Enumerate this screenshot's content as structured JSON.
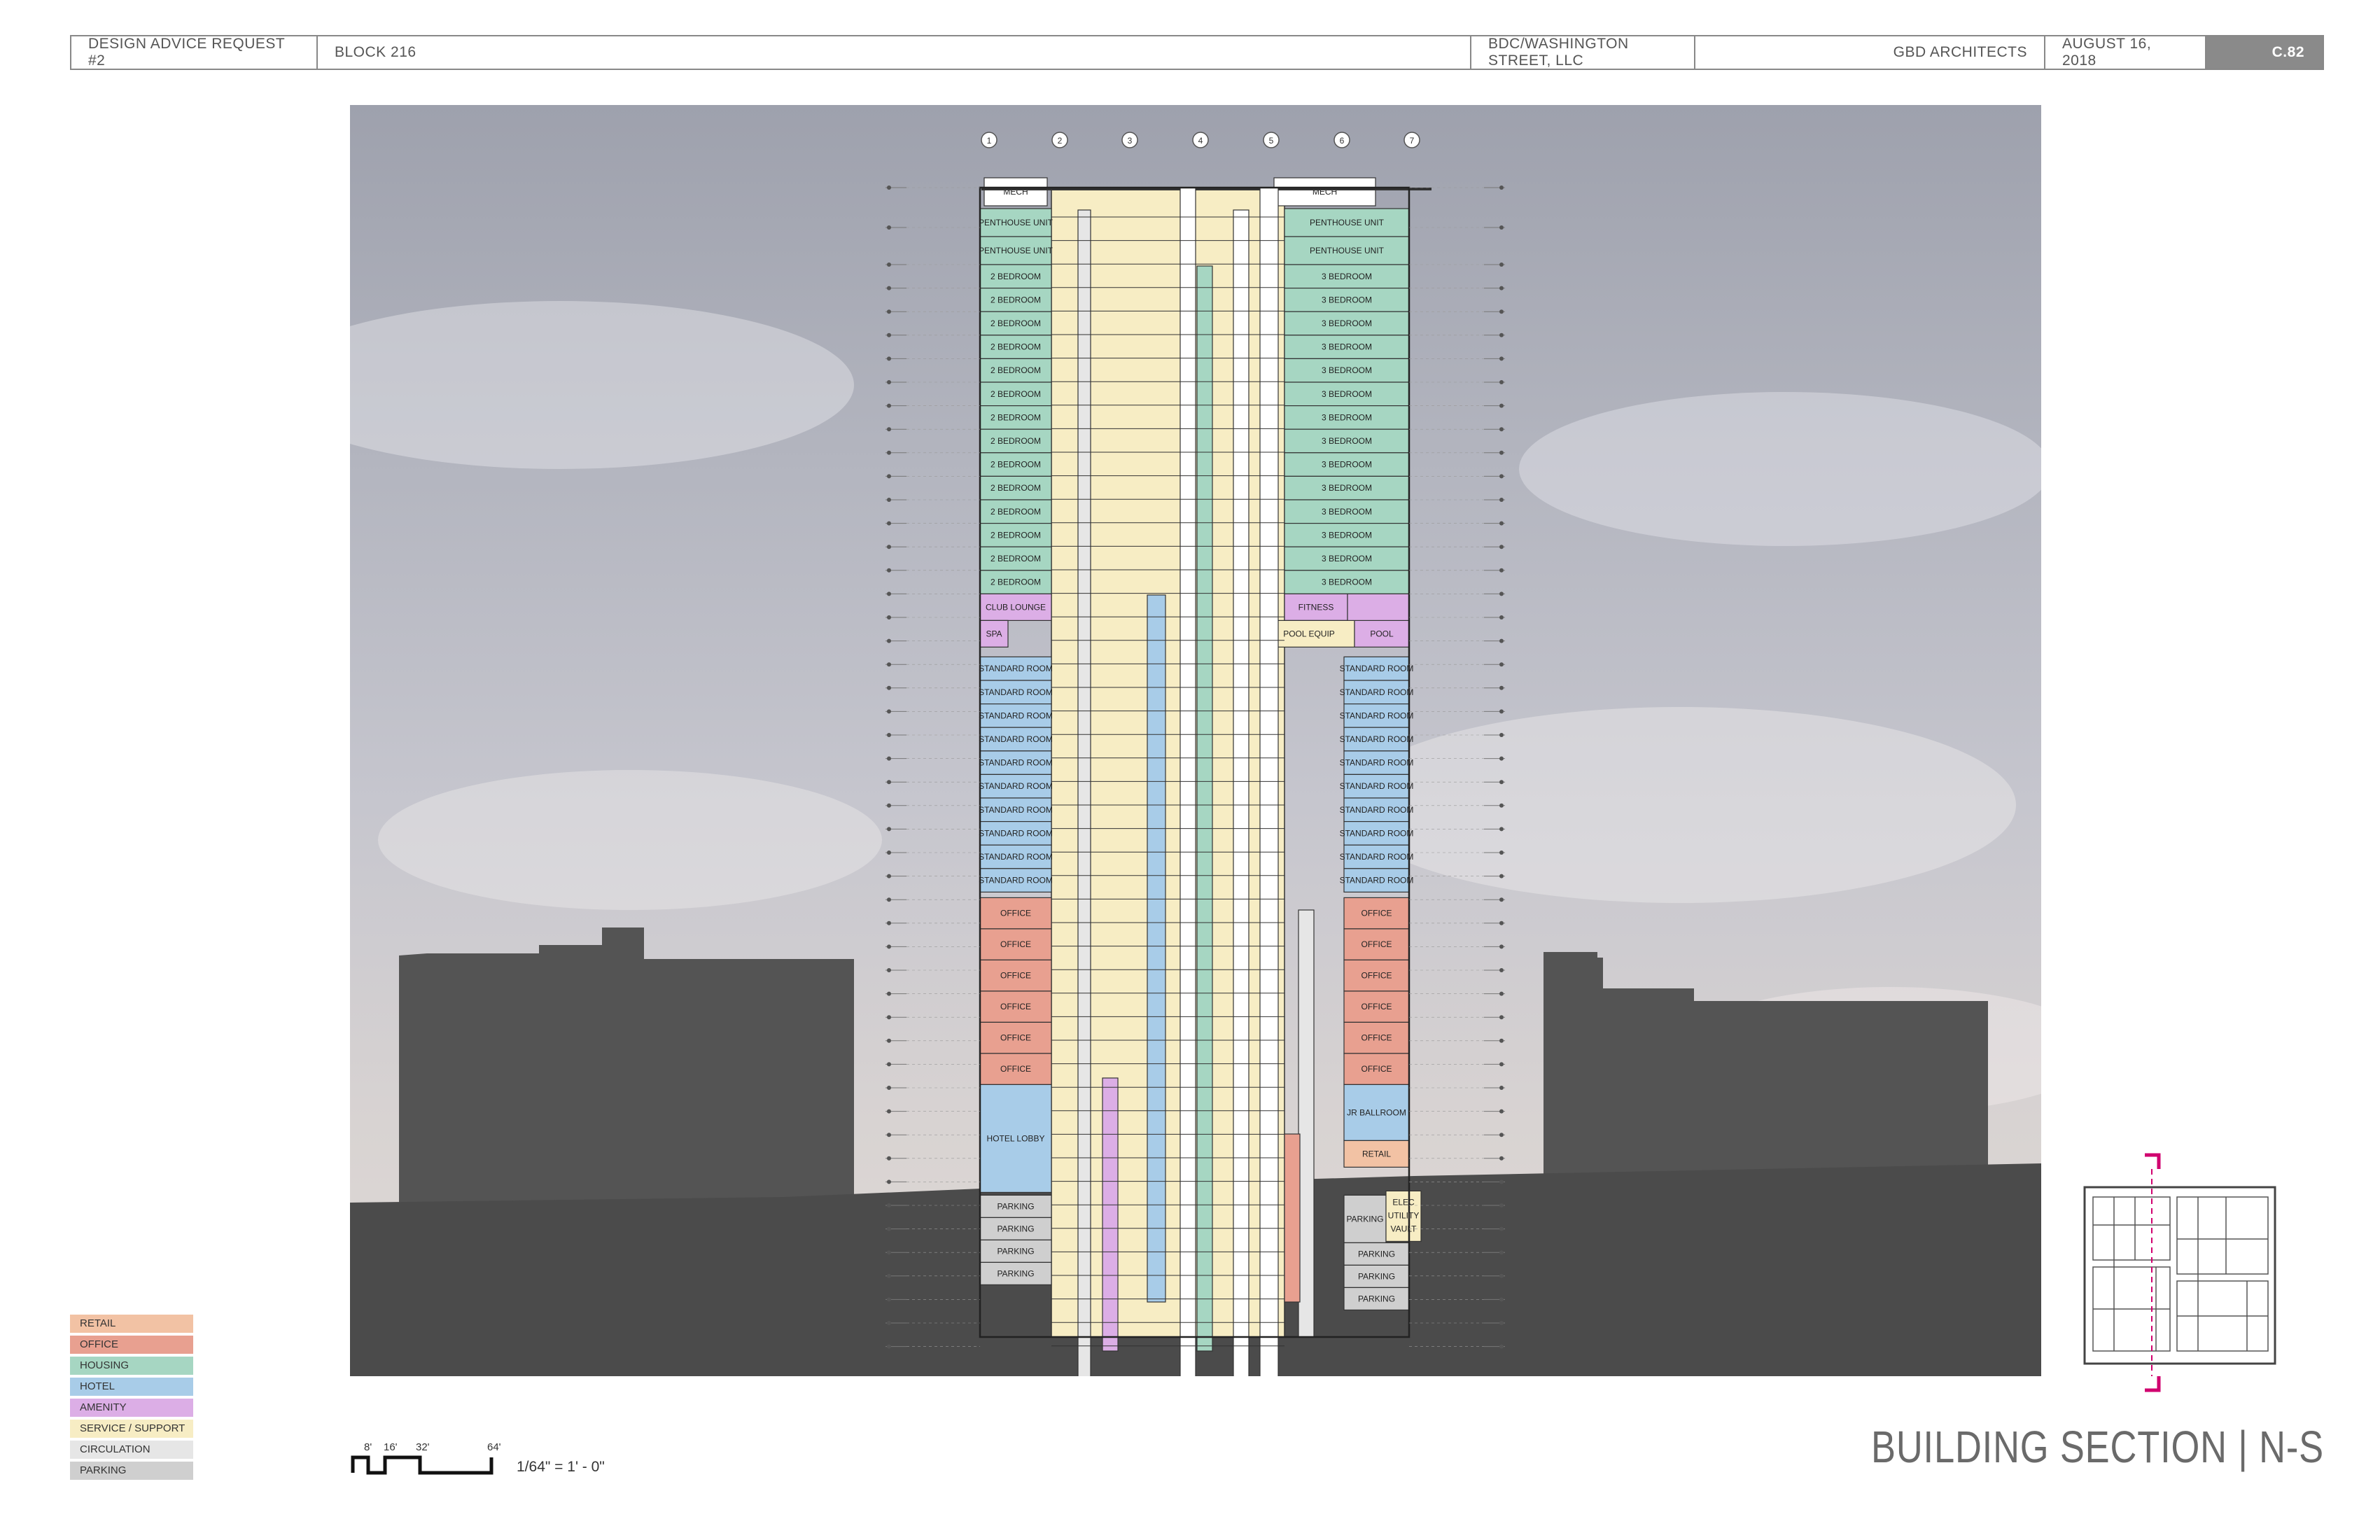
{
  "header": {
    "request": "DESIGN ADVICE REQUEST #2",
    "block": "BLOCK 216",
    "client": "BDC/WASHINGTON STREET, LLC",
    "architect": "GBD ARCHITECTS",
    "date": "AUGUST 16,  2018",
    "sheet": "C.82"
  },
  "grid_lines": [
    "1",
    "2",
    "3",
    "4",
    "5",
    "6",
    "7"
  ],
  "colors": {
    "retail": "#f2c2a4",
    "office": "#e8a090",
    "housing": "#a6d6c2",
    "hotel": "#a8cce8",
    "amenity": "#dcaee6",
    "service": "#f7edc4",
    "circulation": "#e6e6e6",
    "parking": "#cfcfcf"
  },
  "legend": [
    {
      "label": "RETAIL",
      "color": "#f2c2a4"
    },
    {
      "label": "OFFICE",
      "color": "#e8a090"
    },
    {
      "label": "HOUSING",
      "color": "#a6d6c2"
    },
    {
      "label": "HOTEL",
      "color": "#a8cce8"
    },
    {
      "label": "AMENITY",
      "color": "#dcaee6"
    },
    {
      "label": "SERVICE / SUPPORT",
      "color": "#f7edc4"
    },
    {
      "label": "CIRCULATION",
      "color": "#e6e6e6"
    },
    {
      "label": "PARKING",
      "color": "#cfcfcf"
    }
  ],
  "section": {
    "mech_left": "MECH",
    "mech_right": "MECH",
    "penthouse_left": [
      "PENTHOUSE UNIT",
      "PENTHOUSE UNIT"
    ],
    "penthouse_right": [
      "PENTHOUSE UNIT",
      "PENTHOUSE UNIT"
    ],
    "housing_left": [
      "2 BEDROOM",
      "2 BEDROOM",
      "2 BEDROOM",
      "2 BEDROOM",
      "2 BEDROOM",
      "2 BEDROOM",
      "2 BEDROOM",
      "2 BEDROOM",
      "2 BEDROOM",
      "2 BEDROOM",
      "2 BEDROOM",
      "2 BEDROOM",
      "2 BEDROOM",
      "2 BEDROOM"
    ],
    "housing_right": [
      "3 BEDROOM",
      "3 BEDROOM",
      "3 BEDROOM",
      "3 BEDROOM",
      "3 BEDROOM",
      "3 BEDROOM",
      "3 BEDROOM",
      "3 BEDROOM",
      "3 BEDROOM",
      "3 BEDROOM",
      "3 BEDROOM",
      "3 BEDROOM",
      "3 BEDROOM",
      "3 BEDROOM"
    ],
    "club_lounge": "CLUB LOUNGE",
    "fitness": "FITNESS",
    "spa": "SPA",
    "pool_equip": "POOL EQUIP",
    "pool": "POOL",
    "hotel_left": [
      "STANDARD ROOM",
      "STANDARD ROOM",
      "STANDARD ROOM",
      "STANDARD ROOM",
      "STANDARD ROOM",
      "STANDARD ROOM",
      "STANDARD ROOM",
      "STANDARD ROOM",
      "STANDARD ROOM",
      "STANDARD ROOM"
    ],
    "hotel_right": [
      "STANDARD ROOM",
      "STANDARD ROOM",
      "STANDARD ROOM",
      "STANDARD ROOM",
      "STANDARD ROOM",
      "STANDARD ROOM",
      "STANDARD ROOM",
      "STANDARD ROOM",
      "STANDARD ROOM",
      "STANDARD ROOM"
    ],
    "office_left": [
      "OFFICE",
      "OFFICE",
      "OFFICE",
      "OFFICE",
      "OFFICE",
      "OFFICE"
    ],
    "office_right": [
      "OFFICE",
      "OFFICE",
      "OFFICE",
      "OFFICE",
      "OFFICE",
      "OFFICE"
    ],
    "hotel_lobby": "HOTEL LOBBY",
    "jr_ballroom": "JR BALLROOM",
    "retail": "RETAIL",
    "parking_left": [
      "PARKING",
      "PARKING",
      "PARKING",
      "PARKING"
    ],
    "parking_right": [
      "PARKING",
      "PARKING",
      "PARKING",
      "PARKING"
    ],
    "elec_vault": [
      "ELEC",
      "UTILITY",
      "VAULT"
    ]
  },
  "scale": {
    "ticks": [
      "8'",
      "16'",
      "32'",
      "64'"
    ],
    "note": "1/64\" = 1' - 0\""
  },
  "title": "BUILDING SECTION   |   N-S"
}
